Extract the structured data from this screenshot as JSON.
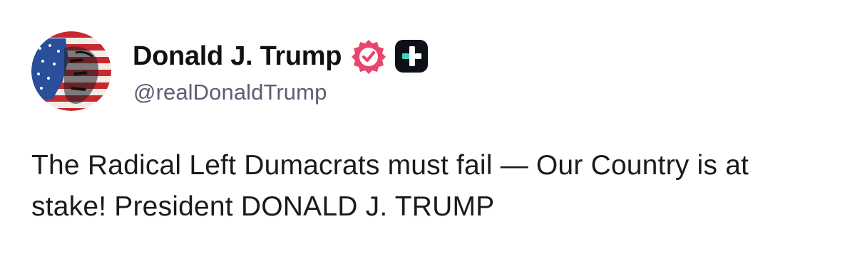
{
  "author": {
    "display_name": "Donald J. Trump",
    "handle": "@realDonaldTrump",
    "avatar_icon": "portrait-flag-avatar",
    "verified_icon": "verified-badge-icon",
    "verified_color": "#e8456f",
    "badge_icon": "plus-badge-icon",
    "badge_color": "#0d1117",
    "badge_accent": "#3ad6c4"
  },
  "post": {
    "text": "The Radical Left Dumacrats must fail — Our Country is at stake! President DONALD J. TRUMP"
  }
}
